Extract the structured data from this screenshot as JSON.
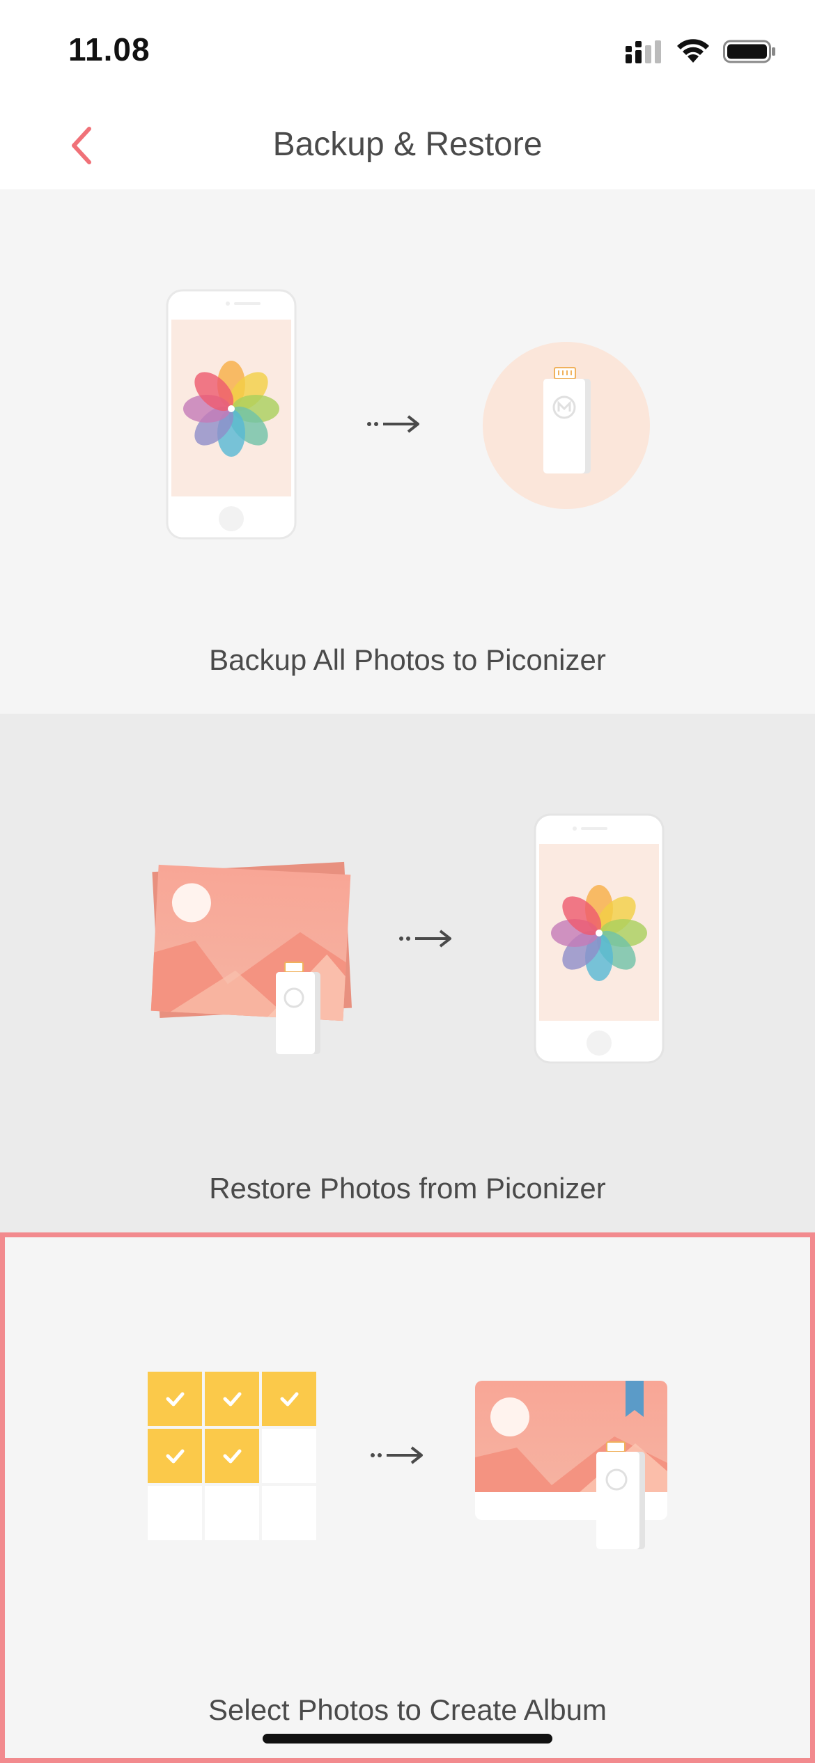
{
  "status_bar": {
    "time": "11.08",
    "icons": [
      "cellular-signal-icon",
      "wifi-icon",
      "battery-icon"
    ]
  },
  "nav": {
    "back_icon": "chevron-left-icon",
    "title": "Backup & Restore"
  },
  "sections": [
    {
      "label": "Backup All Photos to Piconizer",
      "illustration": "phone-photos-to-piconizer"
    },
    {
      "label": "Restore Photos from Piconizer",
      "illustration": "piconizer-photos-to-phone"
    },
    {
      "label": "Select Photos to Create Album",
      "illustration": "select-grid-to-album",
      "selected": true
    }
  ],
  "colors": {
    "accent": "#f07178",
    "selection_border": "#f28a8e",
    "section_light": "#f5f5f5",
    "section_dark": "#ebebeb",
    "check_yellow": "#fbc94a",
    "photo_coral": "#f7a192",
    "bookmark_blue": "#5b9bc8"
  }
}
